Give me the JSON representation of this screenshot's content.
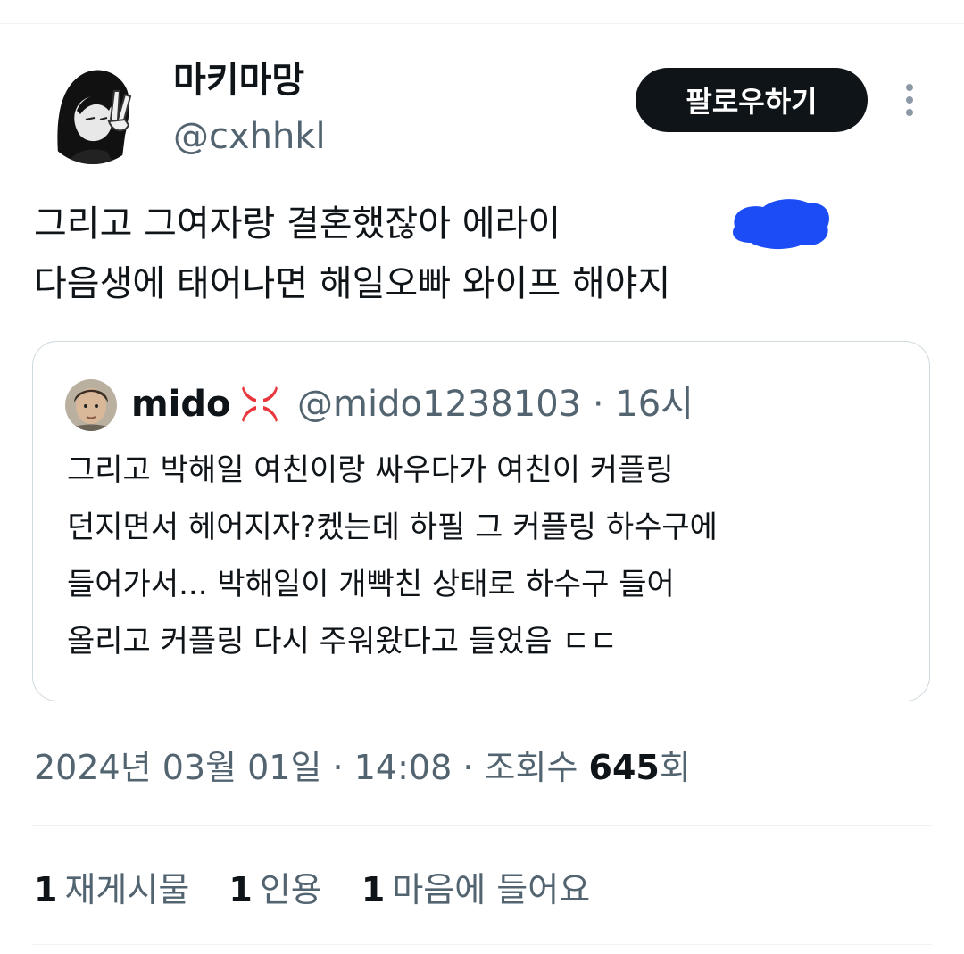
{
  "author": {
    "display_name": "마키마망",
    "handle": "@cxhhkl"
  },
  "follow_button_label": "팔로우하기",
  "tweet": {
    "lines": [
      "그리고 그여자랑 결혼했잖아 에라이",
      "다음생에 태어나면 해일오빠 와이프 해야지"
    ]
  },
  "quote": {
    "display_name": "mido",
    "handle": "@mido1238103",
    "separator": "·",
    "time": "16시",
    "lines": [
      "그리고 박해일 여친이랑 싸우다가 여친이 커플링",
      "던지면서 헤어지자?켔는데 하필 그 커플링 하수구에",
      "들어가서... 박해일이 개빡친 상태로 하수구 들어",
      "올리고 커플링 다시 주워왔다고 들었음 ㄷㄷ"
    ]
  },
  "meta": {
    "date": "2024년 03월 01일",
    "sep": "·",
    "time": "14:08",
    "views_label": "조회수",
    "views_count": "645",
    "views_suffix": "회"
  },
  "stats": [
    {
      "count": "1",
      "label": "재게시물"
    },
    {
      "count": "1",
      "label": "인용"
    },
    {
      "count": "1",
      "label": "마음에 들어요"
    }
  ],
  "colors": {
    "text_primary": "#0f1419",
    "text_secondary": "#536471",
    "border": "#cfd9de",
    "divider": "#eff3f4",
    "redaction_blue": "#1b4cf5",
    "follow_button_bg": "#0f1419"
  },
  "icons": {
    "more": "more-vertical-icon",
    "quote_badge": "anger-symbol-icon"
  }
}
